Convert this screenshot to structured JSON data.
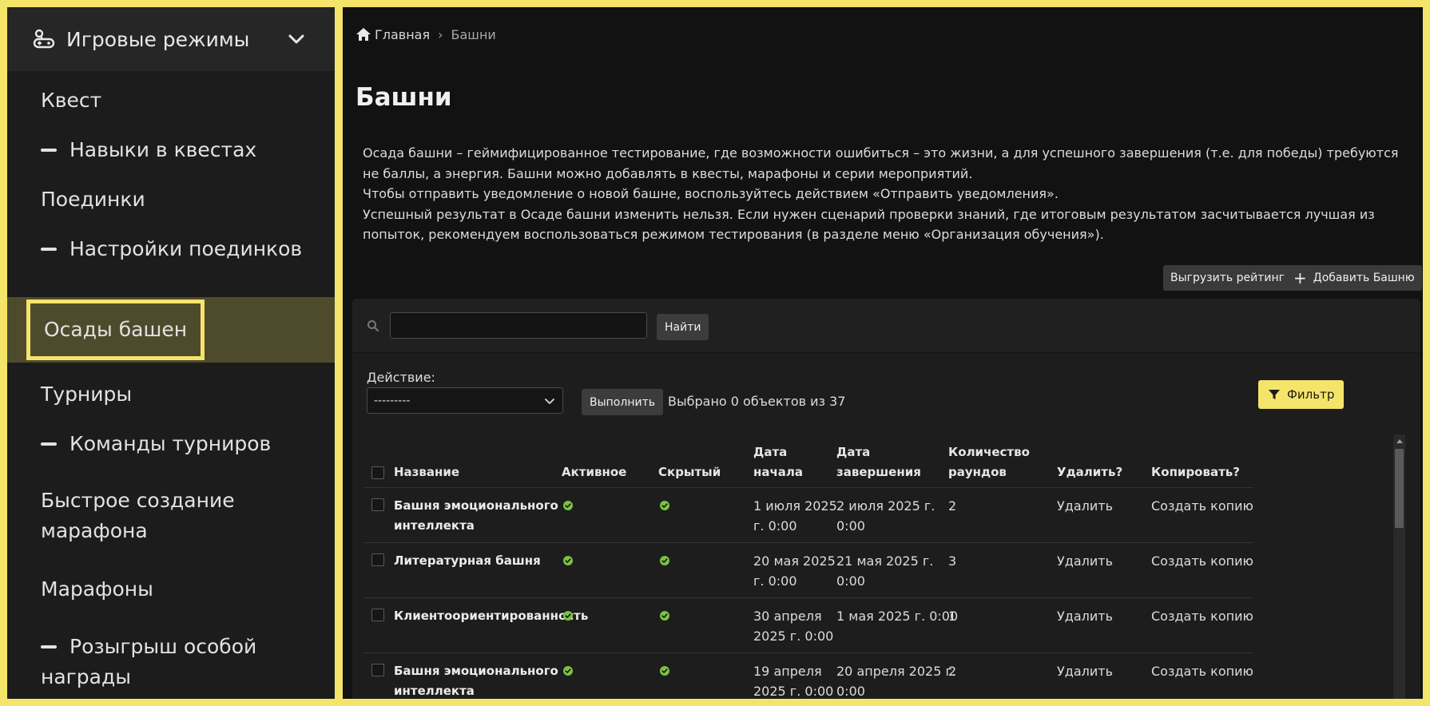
{
  "sidebar": {
    "section_title": "Игровые режимы",
    "items": [
      {
        "label": "Квест",
        "sub": false
      },
      {
        "label": "Навыки в квестах",
        "sub": true
      },
      {
        "label": "Поединки",
        "sub": false
      },
      {
        "label": "Настройки поединков",
        "sub": true
      },
      {
        "label": "Осады башен",
        "sub": false,
        "active": true
      },
      {
        "label": "Турниры",
        "sub": false
      },
      {
        "label": "Команды турниров",
        "sub": true
      },
      {
        "label": "Быстрое создание марафона",
        "line1": "Быстрое создание",
        "line2": "марафона",
        "sub": false
      },
      {
        "label": "Марафоны",
        "sub": false
      },
      {
        "label": "Розыгрыш особой награды",
        "line1": "Розыгрыш особой",
        "line2": "награды",
        "sub": true
      }
    ]
  },
  "breadcrumb": {
    "home": "Главная",
    "separator": "›",
    "current": "Башни"
  },
  "page": {
    "title": "Башни",
    "description": [
      "Осада башни – геймифицированное тестирование, где возможности ошибиться – это жизни, а для успешного завершения (т.е. для победы) требуются не баллы, а энергия. Башни можно добавлять в квесты, марафоны и серии мероприятий.",
      "Чтобы отправить уведомление о новой башне, воспользуйтесь действием «Отправить уведомления».",
      "Успешный результат в Осаде башни изменить нельзя. Если нужен сценарий проверки знаний, где итоговым результатом засчитывается лучшая из попыток, рекомендуем воспользоваться режимом тестирования (в разделе меню «Организация обучения»)."
    ],
    "export_label": "Выгрузить рейтинг",
    "add_label": "Добавить Башню"
  },
  "search": {
    "value": "",
    "button": "Найти"
  },
  "actions": {
    "label": "Действие:",
    "selected": "---------",
    "run_label": "Выполнить",
    "count_text": "Выбрано 0 объектов из 37",
    "filter_label": "Фильтр"
  },
  "table": {
    "headers": {
      "name": "Название",
      "active": "Активное",
      "hidden": "Скрытый",
      "start_1": "Дата",
      "start_2": "начала",
      "end_1": "Дата",
      "end_2": "завершения",
      "rounds_1": "Количество",
      "rounds_2": "раундов",
      "delete": "Удалить?",
      "copy": "Копировать?"
    },
    "rows": [
      {
        "name_1": "Башня эмоционального",
        "name_2": "интеллекта",
        "active": true,
        "hidden": true,
        "start_1": "1 июля 2025",
        "start_2": "г. 0:00",
        "end_1": "2 июля 2025 г.",
        "end_2": "0:00",
        "rounds": "2",
        "delete": "Удалить",
        "copy": "Создать копию"
      },
      {
        "name_1": "Литературная башня",
        "name_2": "",
        "active": true,
        "hidden": true,
        "start_1": "20 мая 2025",
        "start_2": "г. 0:00",
        "end_1": "21 мая 2025 г.",
        "end_2": "0:00",
        "rounds": "3",
        "delete": "Удалить",
        "copy": "Создать копию"
      },
      {
        "name_1": "Клиентоориентированность",
        "name_2": "",
        "active": true,
        "hidden": true,
        "start_1": "30 апреля",
        "start_2": "2025 г. 0:00",
        "end_1": "1 мая 2025 г. 0:00",
        "end_2": "",
        "rounds": "1",
        "delete": "Удалить",
        "copy": "Создать копию"
      },
      {
        "name_1": "Башня эмоционального",
        "name_2": "интеллекта",
        "active": true,
        "hidden": true,
        "start_1": "19 апреля",
        "start_2": "2025 г. 0:00",
        "end_1": "20 апреля 2025 г.",
        "end_2": "0:00",
        "rounds": "2",
        "delete": "Удалить",
        "copy": "Создать копию"
      }
    ]
  },
  "colors": {
    "accent": "#f5e46a",
    "active_bg": "#4e4b2c",
    "check": "#7cc242"
  },
  "icons": {
    "section": "game-controller-icon",
    "home": "home-icon",
    "search": "search-icon",
    "filter": "filter-icon",
    "check": "check-circle-icon"
  }
}
